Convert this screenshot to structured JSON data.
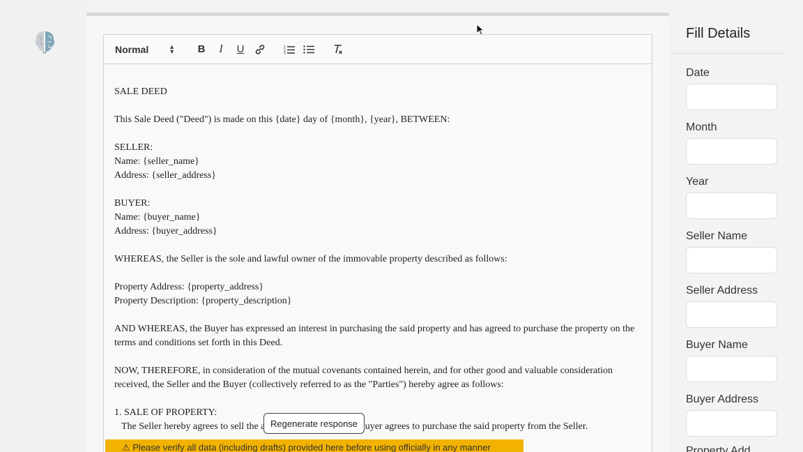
{
  "editor": {
    "toolbar": {
      "format_select": "Normal",
      "icons": [
        "bold-icon",
        "italic-icon",
        "underline-icon",
        "link-icon",
        "ordered-list-icon",
        "bullet-list-icon",
        "clear-format-icon"
      ]
    },
    "doc": {
      "title": "SALE DEED",
      "intro": "This Sale Deed (\"Deed\") is made on this {date} day of {month}, {year}, BETWEEN:",
      "seller_head": "SELLER:",
      "seller_name": "Name: {seller_name}",
      "seller_address": "Address: {seller_address}",
      "buyer_head": "BUYER:",
      "buyer_name": "Name: {buyer_name}",
      "buyer_address": "Address: {buyer_address}",
      "whereas": "WHEREAS, the Seller is the sole and lawful owner of the immovable property described as follows:",
      "property_address": "Property Address: {property_address}",
      "property_description": "Property Description: {property_description}",
      "and_whereas": "AND WHEREAS, the Buyer has expressed an interest in purchasing the said property and has agreed to purchase the property on the terms and conditions set forth in this Deed.",
      "now_therefore": "NOW, THEREFORE, in consideration of the mutual covenants contained herein, and for other good and valuable consideration received, the Seller and the Buyer (collectively referred to as the \"Parties\") hereby agree as follows:",
      "section1_head": "1. SALE OF PROPERTY:",
      "section1_body": "The Seller hereby agrees to sell the a... to the Buyer, and the Buyer agrees to purchase the said property from the Seller."
    }
  },
  "regenerate_label": "Regenerate response",
  "warning": "⚠ Please verify all data (including drafts) provided here before using officially in any manner",
  "side": {
    "title": "Fill Details",
    "fields": [
      {
        "label": "Date",
        "value": ""
      },
      {
        "label": "Month",
        "value": ""
      },
      {
        "label": "Year",
        "value": ""
      },
      {
        "label": "Seller Name",
        "value": ""
      },
      {
        "label": "Seller Address",
        "value": ""
      },
      {
        "label": "Buyer Name",
        "value": ""
      },
      {
        "label": "Buyer Address",
        "value": ""
      },
      {
        "label": "Property Add...",
        "value": ""
      }
    ]
  },
  "colors": {
    "warning": "#f2b200",
    "logo": "#7fa6b5"
  }
}
